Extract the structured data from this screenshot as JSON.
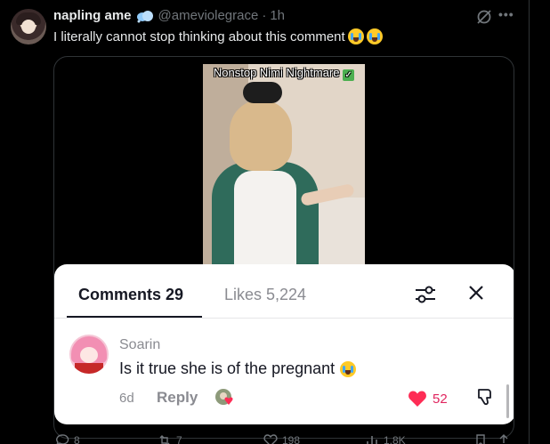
{
  "tweet": {
    "author_name": "napling ame",
    "handle": "@ameviolegrace",
    "separator": "·",
    "time": "1h",
    "text": "I literally cannot stop thinking about this comment"
  },
  "video": {
    "caption": "Nonstop Nimi Nightmare"
  },
  "comments_panel": {
    "tab_comments": "Comments 29",
    "tab_likes": "Likes 5,224",
    "comment": {
      "author": "Soarin",
      "text": "Is it true she is of the pregnant",
      "age": "6d",
      "reply_label": "Reply",
      "likes": "52"
    }
  },
  "actions": {
    "replies": "8",
    "reposts": "7",
    "likes": "198",
    "views": "1.8K"
  },
  "colors": {
    "background": "#000000",
    "text": "#e7e9ea",
    "muted": "#71767b",
    "like_red": "#e0245e"
  }
}
